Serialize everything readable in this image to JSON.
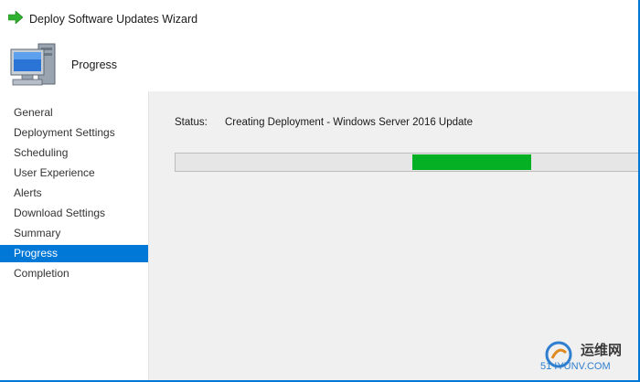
{
  "window": {
    "title": "Deploy Software Updates Wizard",
    "header_title": "Progress",
    "title_icon": "green-arrow-icon",
    "header_icon": "computer-icon"
  },
  "sidebar": {
    "items": [
      {
        "label": "General",
        "active": false
      },
      {
        "label": "Deployment Settings",
        "active": false
      },
      {
        "label": "Scheduling",
        "active": false
      },
      {
        "label": "User Experience",
        "active": false
      },
      {
        "label": "Alerts",
        "active": false
      },
      {
        "label": "Download Settings",
        "active": false
      },
      {
        "label": "Summary",
        "active": false
      },
      {
        "label": "Progress",
        "active": true
      },
      {
        "label": "Completion",
        "active": false
      }
    ]
  },
  "main": {
    "status_label": "Status:",
    "status_value": "Creating Deployment - Windows Server 2016 Update",
    "progress": {
      "type": "marquee",
      "chunk_start_fraction": 0.5,
      "chunk_end_fraction": 0.75
    }
  },
  "watermark": {
    "line1": "运维网",
    "line2": "51 IYUNV.COM"
  },
  "colors": {
    "accent": "#0078d7",
    "progress": "#06b025",
    "content_bg": "#f0f0f0"
  }
}
